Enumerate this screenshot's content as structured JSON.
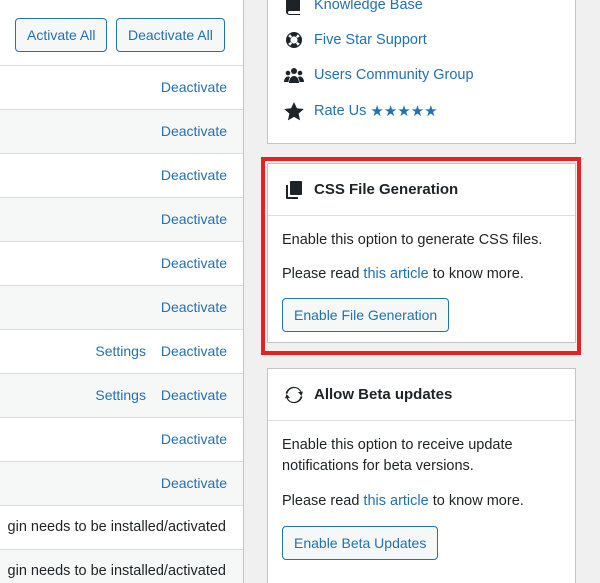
{
  "toolbar": {
    "activate_all": "Activate All",
    "deactivate_all": "Deactivate All"
  },
  "plugin_rows": [
    {
      "actions": [
        "Deactivate"
      ]
    },
    {
      "actions": [
        "Deactivate"
      ]
    },
    {
      "actions": [
        "Deactivate"
      ]
    },
    {
      "actions": [
        "Deactivate"
      ]
    },
    {
      "actions": [
        "Deactivate"
      ]
    },
    {
      "actions": [
        "Deactivate"
      ]
    },
    {
      "actions": [
        "Settings",
        "Deactivate"
      ]
    },
    {
      "actions": [
        "Settings",
        "Deactivate"
      ]
    },
    {
      "actions": [
        "Deactivate"
      ]
    },
    {
      "actions": [
        "Deactivate"
      ]
    }
  ],
  "row_labels": {
    "deactivate": "Deactivate",
    "settings": "Settings"
  },
  "messages": [
    "gin needs to be installed/activated",
    "gin needs to be installed/activated"
  ],
  "links": {
    "knowledge_base": "Knowledge Base",
    "five_star_support": "Five Star Support",
    "community_group": "Users Community Group",
    "rate_us": "Rate Us",
    "stars": "★★★★★"
  },
  "css_generation": {
    "title": "CSS File Generation",
    "description": "Enable this option to generate CSS files.",
    "read_prefix": "Please read ",
    "read_link": "this article",
    "read_suffix": " to know more.",
    "button": "Enable File Generation"
  },
  "beta_updates": {
    "title": "Allow Beta updates",
    "description": "Enable this option to receive update notifications for beta versions.",
    "read_prefix": "Please read ",
    "read_link": "this article",
    "read_suffix": " to know more.",
    "button": "Enable Beta Updates"
  },
  "colors": {
    "link": "#2271b1",
    "highlight": "#e8201f"
  }
}
